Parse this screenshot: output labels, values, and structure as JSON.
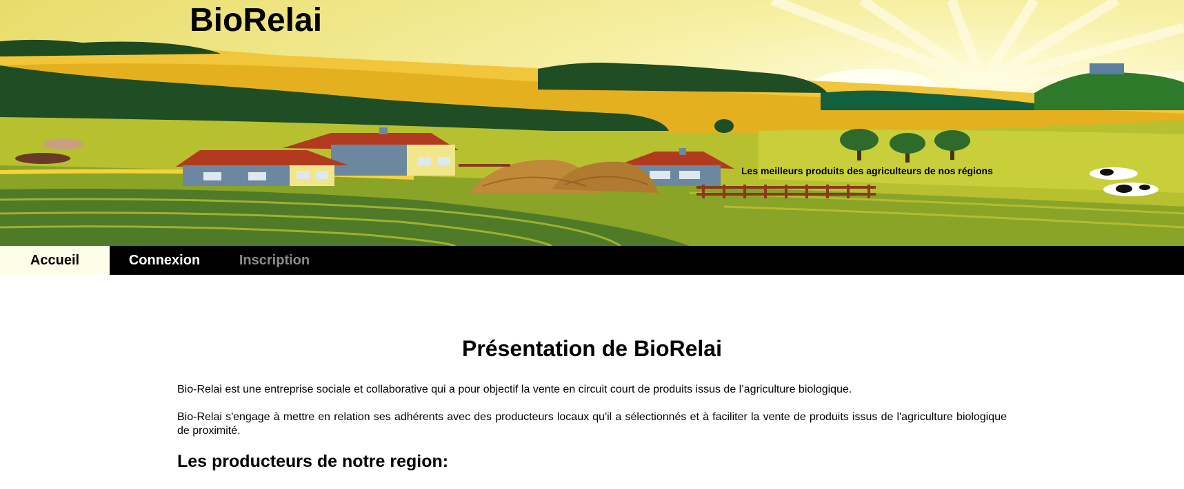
{
  "header": {
    "site_title": "BioRelai",
    "tagline": "Les meilleurs produits des agriculteurs de nos régions"
  },
  "nav": {
    "items": [
      {
        "label": "Accueil"
      },
      {
        "label": "Connexion"
      },
      {
        "label": "Inscription"
      }
    ]
  },
  "main": {
    "title": "Présentation de BioRelai",
    "paragraphs": [
      "Bio-Relai est une entreprise sociale et collaborative qui a pour objectif la vente en circuit court de produits issus de l’agriculture biologique.",
      "Bio-Relai s'engage à mettre en relation ses adhérents avec des producteurs locaux qu'il a sélectionnés et à faciliter la vente de produits issus de l'agriculture biologique de proximité."
    ],
    "section_title": "Les producteurs de notre region:"
  },
  "colors": {
    "nav_background": "#000000",
    "nav_active_background": "#fefde8",
    "nav_disabled_text": "#8a8a8a"
  }
}
